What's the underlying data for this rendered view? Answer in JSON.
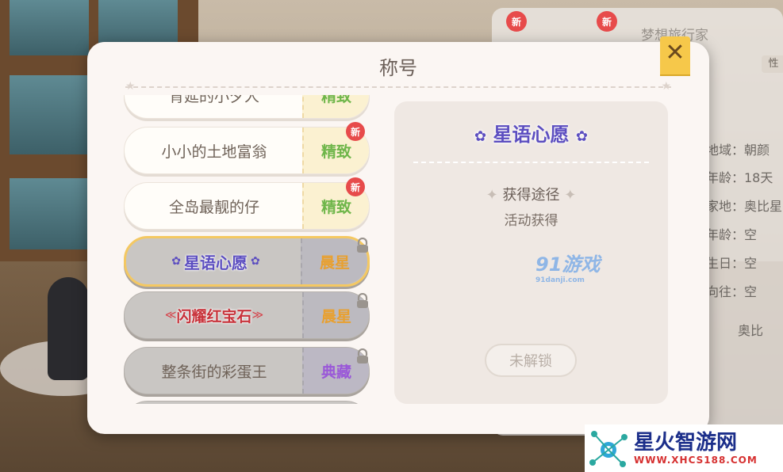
{
  "dialog": {
    "title": "称号",
    "close_label": "✕"
  },
  "titles": [
    {
      "label": "背延的小夕人",
      "tier": "精致",
      "locked": false,
      "new": false
    },
    {
      "label": "小小的土地富翁",
      "tier": "精致",
      "locked": false,
      "new": true
    },
    {
      "label": "全岛最靓的仔",
      "tier": "精致",
      "locked": false,
      "new": true
    },
    {
      "label": "星语心愿",
      "tier": "晨星",
      "locked": true,
      "selected": true
    },
    {
      "label": "闪耀红宝石",
      "tier": "晨星",
      "locked": true
    },
    {
      "label": "整条街的彩蛋王",
      "tier": "典藏",
      "locked": true
    }
  ],
  "new_badge": "新",
  "detail": {
    "title": "星语心愿",
    "obtain_heading": "获得途径",
    "obtain_method": "活动获得",
    "unlock_button": "未解锁"
  },
  "profile": {
    "name": "梦想旅行家",
    "tag": "性",
    "info": [
      "地域：朝颜",
      "年龄：18天",
      "家地：奥比星",
      "年龄：空",
      "生日：空",
      "向往：空",
      "奥比"
    ]
  },
  "watermarks": {
    "site91_main": "91游戏",
    "site91_sub": "91danji.com",
    "brand_main": "星火智游网",
    "brand_url": "WWW.XHCS188.COM"
  },
  "colors": {
    "tier_jingzhi": "#6fb64a",
    "tier_chenxing": "#e8a030",
    "tier_diancang": "#9a58d8",
    "accent_close": "#f6c84a",
    "fancy_purple": "#5c4ec0"
  }
}
